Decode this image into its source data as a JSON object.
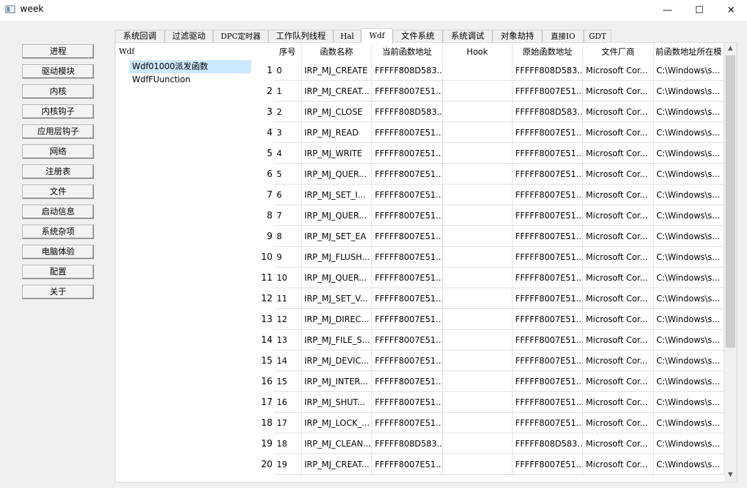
{
  "window": {
    "title": "week",
    "minimize": "—",
    "maximize": "☐",
    "close": "✕"
  },
  "sidebar": {
    "buttons": [
      "进程",
      "驱动模块",
      "内核",
      "内核钩子",
      "应用层钩子",
      "网络",
      "注册表",
      "文件",
      "启动信息",
      "系统杂项",
      "电脑体验",
      "配置",
      "关于"
    ]
  },
  "tabs": [
    "系统回调",
    "过滤驱动",
    "DPC定时器",
    "工作队列线程",
    "Hal",
    "Wdf",
    "文件系统",
    "系统调试",
    "对象劫持",
    "直接IO",
    "GDT"
  ],
  "active_tab": "Wdf",
  "tree": {
    "root": "Wdf",
    "items": [
      "Wdf01000派发函数",
      "WdfFUunction"
    ],
    "selected": 0
  },
  "table": {
    "columns": [
      "序号",
      "函数名称",
      "当前函数地址",
      "Hook",
      "原始函数地址",
      "文件厂商",
      "前函数地址所在模"
    ],
    "rows": [
      [
        "1",
        "0",
        "IRP_MJ_CREATE",
        "FFFFF808D583...",
        "",
        "FFFFF808D583...",
        "Microsoft Cor...",
        "C:\\Windows\\s..."
      ],
      [
        "2",
        "1",
        "IRP_MJ_CREAT...",
        "FFFFF8007E51...",
        "",
        "FFFFF8007E51...",
        "Microsoft Cor...",
        "C:\\Windows\\s..."
      ],
      [
        "3",
        "2",
        "IRP_MJ_CLOSE",
        "FFFFF808D583...",
        "",
        "FFFFF808D583...",
        "Microsoft Cor...",
        "C:\\Windows\\s..."
      ],
      [
        "4",
        "3",
        "IRP_MJ_READ",
        "FFFFF8007E51...",
        "",
        "FFFFF8007E51...",
        "Microsoft Cor...",
        "C:\\Windows\\s..."
      ],
      [
        "5",
        "4",
        "IRP_MJ_WRITE",
        "FFFFF8007E51...",
        "",
        "FFFFF8007E51...",
        "Microsoft Cor...",
        "C:\\Windows\\s..."
      ],
      [
        "6",
        "5",
        "IRP_MJ_QUER...",
        "FFFFF8007E51...",
        "",
        "FFFFF8007E51...",
        "Microsoft Cor...",
        "C:\\Windows\\s..."
      ],
      [
        "7",
        "6",
        "IRP_MJ_SET_I...",
        "FFFFF8007E51...",
        "",
        "FFFFF8007E51...",
        "Microsoft Cor...",
        "C:\\Windows\\s..."
      ],
      [
        "8",
        "7",
        "IRP_MJ_QUER...",
        "FFFFF8007E51...",
        "",
        "FFFFF8007E51...",
        "Microsoft Cor...",
        "C:\\Windows\\s..."
      ],
      [
        "9",
        "8",
        "IRP_MJ_SET_EA",
        "FFFFF8007E51...",
        "",
        "FFFFF8007E51...",
        "Microsoft Cor...",
        "C:\\Windows\\s..."
      ],
      [
        "10",
        "9",
        "IRP_MJ_FLUSH...",
        "FFFFF8007E51...",
        "",
        "FFFFF8007E51...",
        "Microsoft Cor...",
        "C:\\Windows\\s..."
      ],
      [
        "11",
        "10",
        "IRP_MJ_QUER...",
        "FFFFF8007E51...",
        "",
        "FFFFF8007E51...",
        "Microsoft Cor...",
        "C:\\Windows\\s..."
      ],
      [
        "12",
        "11",
        "IRP_MJ_SET_V...",
        "FFFFF8007E51...",
        "",
        "FFFFF8007E51...",
        "Microsoft Cor...",
        "C:\\Windows\\s..."
      ],
      [
        "13",
        "12",
        "IRP_MJ_DIREC...",
        "FFFFF8007E51...",
        "",
        "FFFFF8007E51...",
        "Microsoft Cor...",
        "C:\\Windows\\s..."
      ],
      [
        "14",
        "13",
        "IRP_MJ_FILE_S...",
        "FFFFF8007E51...",
        "",
        "FFFFF8007E51...",
        "Microsoft Cor...",
        "C:\\Windows\\s..."
      ],
      [
        "15",
        "14",
        "IRP_MJ_DEVIC...",
        "FFFFF8007E51...",
        "",
        "FFFFF8007E51...",
        "Microsoft Cor...",
        "C:\\Windows\\s..."
      ],
      [
        "16",
        "15",
        "IRP_MJ_INTER...",
        "FFFFF8007E51...",
        "",
        "FFFFF8007E51...",
        "Microsoft Cor...",
        "C:\\Windows\\s..."
      ],
      [
        "17",
        "16",
        "IRP_MJ_SHUT...",
        "FFFFF8007E51...",
        "",
        "FFFFF8007E51...",
        "Microsoft Cor...",
        "C:\\Windows\\s..."
      ],
      [
        "18",
        "17",
        "IRP_MJ_LOCK_...",
        "FFFFF8007E51...",
        "",
        "FFFFF8007E51...",
        "Microsoft Cor...",
        "C:\\Windows\\s..."
      ],
      [
        "19",
        "18",
        "IRP_MJ_CLEAN...",
        "FFFFF808D583...",
        "",
        "FFFFF808D583...",
        "Microsoft Cor...",
        "C:\\Windows\\s..."
      ],
      [
        "20",
        "19",
        "IRP_MJ_CREAT...",
        "FFFFF8007E51...",
        "",
        "FFFFF8007E51...",
        "Microsoft Cor...",
        "C:\\Windows\\s..."
      ]
    ]
  },
  "scrollbar": {
    "up": "▲",
    "down": "▼"
  },
  "colors": {
    "selection": "#cce8ff",
    "window_bg": "#f0f0f0"
  }
}
